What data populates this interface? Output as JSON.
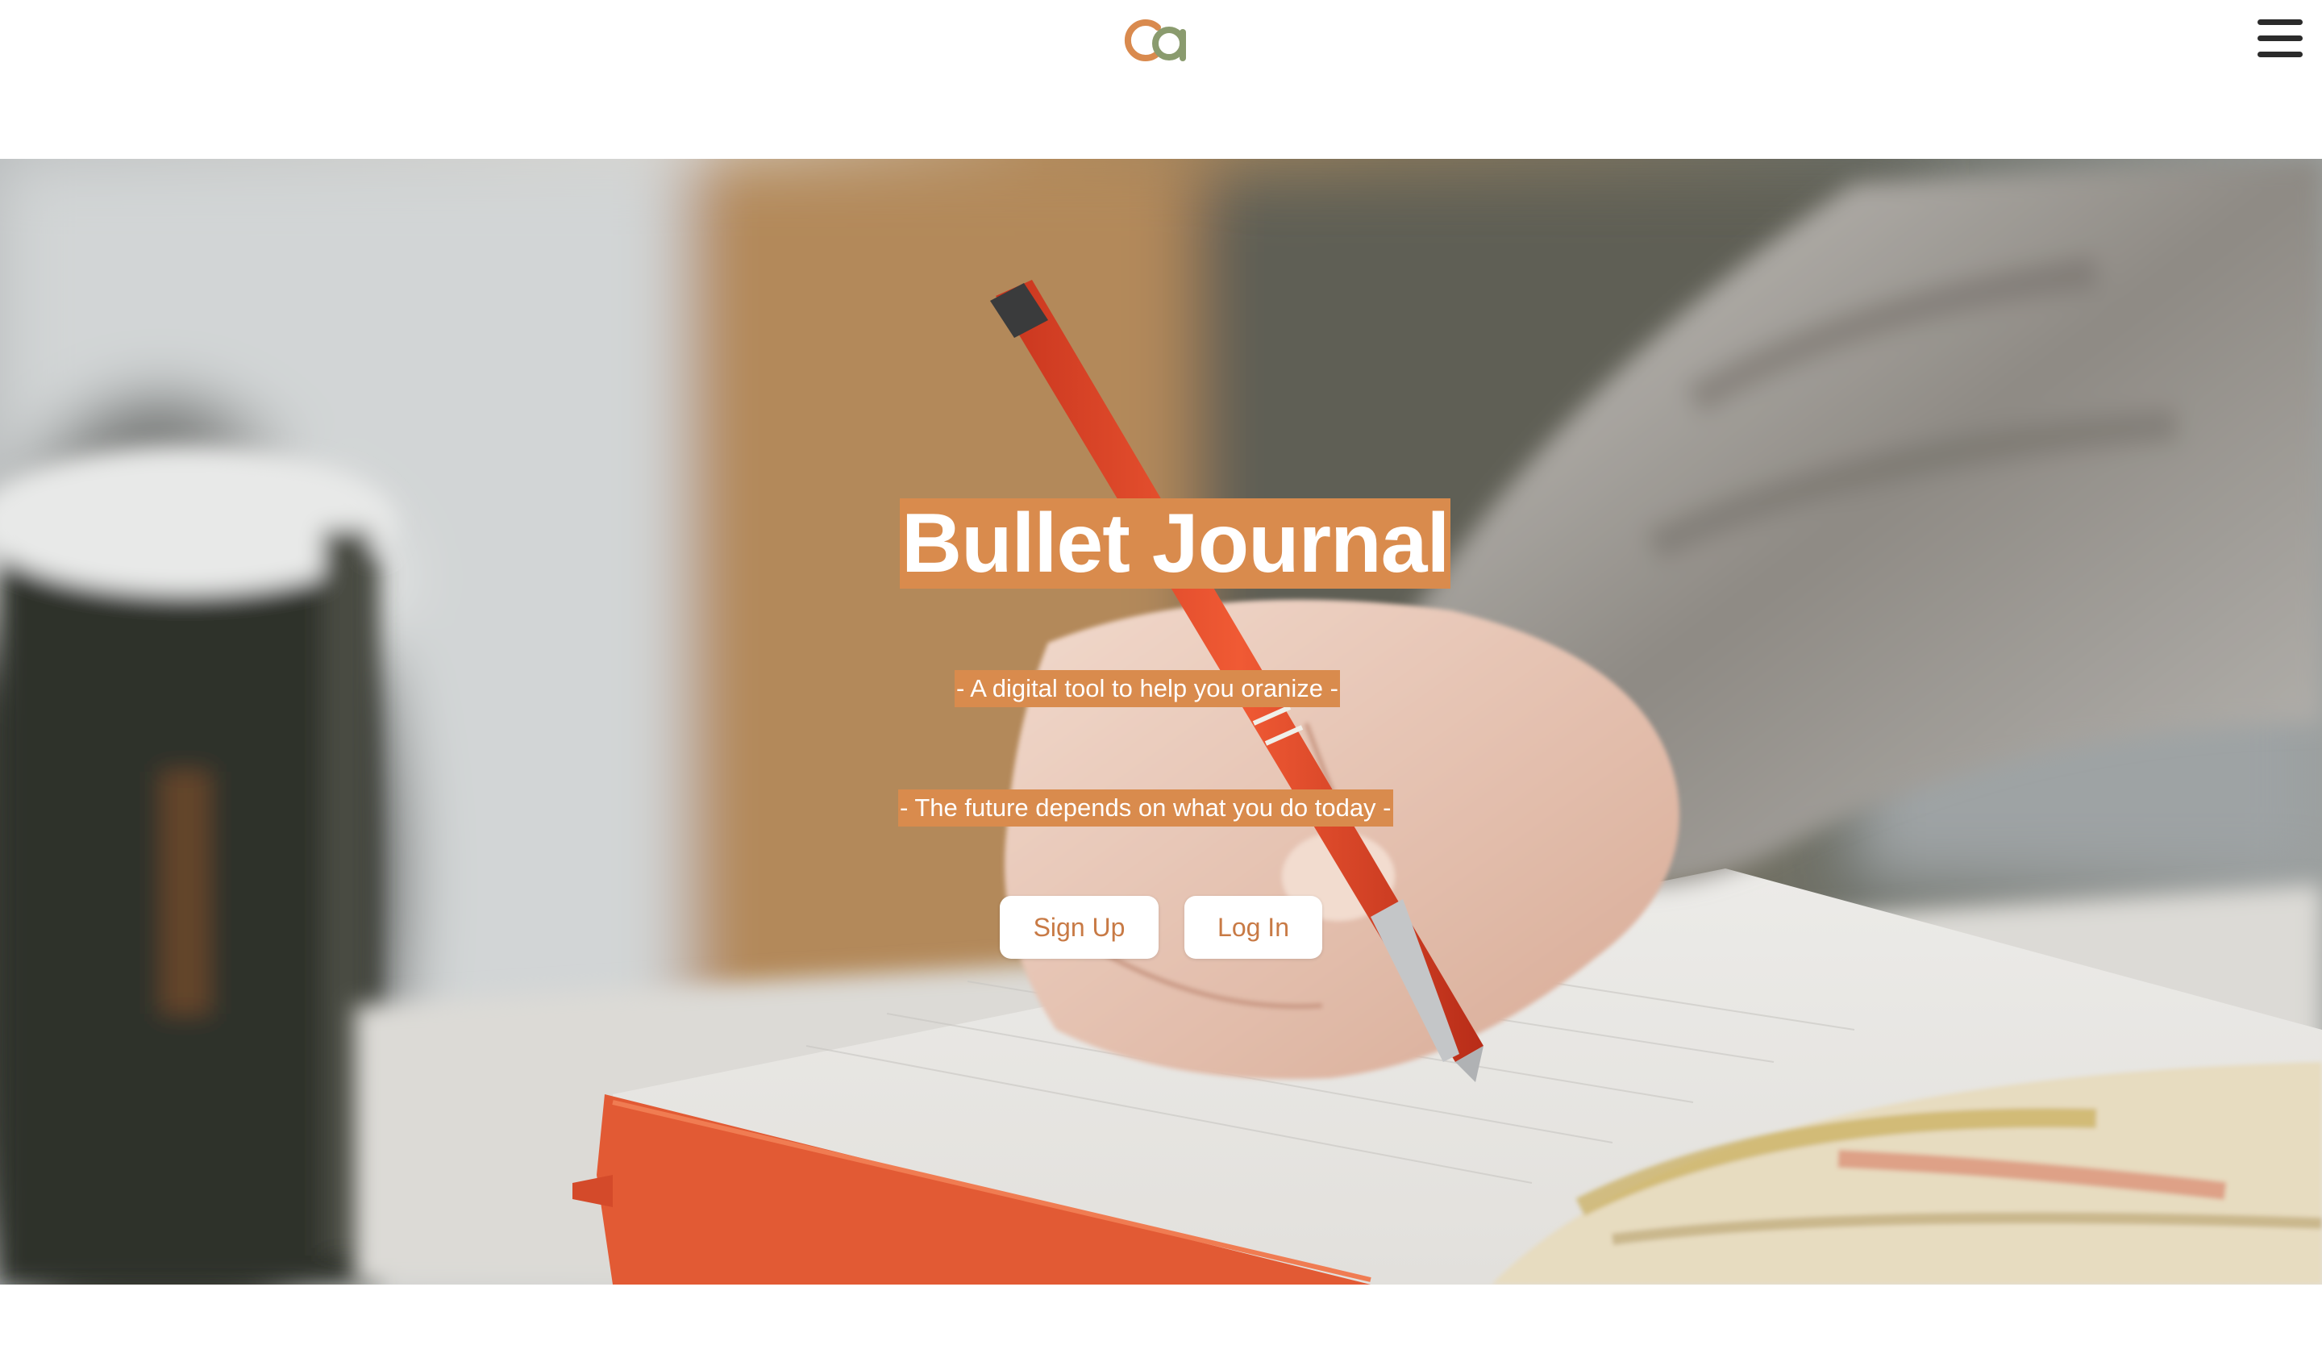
{
  "header": {
    "logo_name": "logo-ca-icon",
    "menu_icon": "hamburger-menu-icon"
  },
  "hero": {
    "title": "Bullet Journal",
    "tagline_1": "- A digital tool to help you oranize -",
    "tagline_2": "- The future depends on what you do today -",
    "signup_label": "Sign Up",
    "login_label": "Log In"
  },
  "colors": {
    "accent": "#d98b4d",
    "button_text": "#c87a45",
    "logo_orange": "#d98a4e",
    "logo_green": "#8a9b6e"
  }
}
